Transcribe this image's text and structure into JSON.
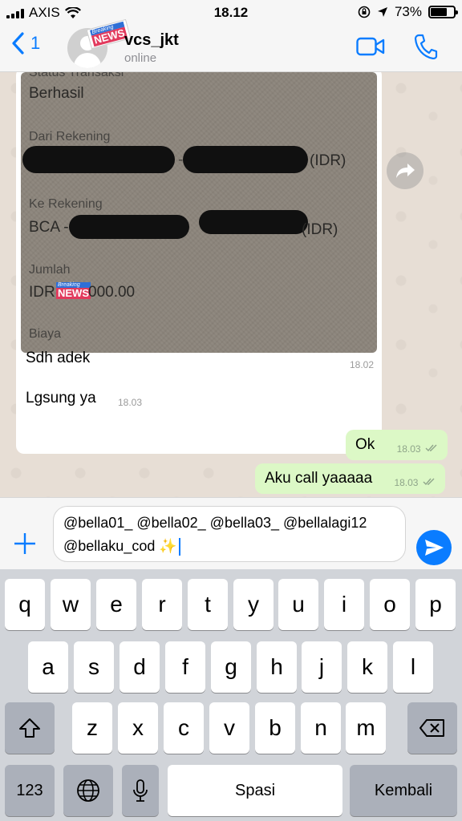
{
  "status_bar": {
    "carrier": "AXIS",
    "time": "18.12",
    "battery_percent": "73%",
    "battery_level": 0.73
  },
  "header": {
    "back_count": "1",
    "contact_name": "vcs_jkt",
    "contact_status": "online",
    "badge_top": "Breaking",
    "badge_bottom": "NEWS"
  },
  "chat": {
    "receipt": {
      "status_label": "Status Transaksi",
      "status_value": "Berhasil",
      "from_label": "Dari Rekening",
      "from_suffix": "(IDR)",
      "to_label": "Ke Rekening",
      "to_prefix": "BCA -",
      "to_suffix": "(IDR)",
      "amount_label": "Jumlah",
      "amount_prefix": "IDR",
      "amount_suffix": "000.00",
      "fee_label": "Biaya",
      "badge_top": "Breaking",
      "badge_bottom": "NEWS"
    },
    "messages": [
      {
        "direction": "in",
        "text": "Sdh adek",
        "time": "18.02"
      },
      {
        "direction": "in",
        "text": "Lgsung ya",
        "time": "18.03"
      },
      {
        "direction": "out",
        "text": "Ok",
        "time": "18.03"
      },
      {
        "direction": "out",
        "text": "Aku call yaaaaa",
        "time": "18.03"
      }
    ]
  },
  "composer": {
    "line1": "@bella01_ @bella02_ @bella03_ @bellalagi12",
    "line2": "@bellaku_cod ✨"
  },
  "keyboard": {
    "row1": [
      "q",
      "w",
      "e",
      "r",
      "t",
      "y",
      "u",
      "i",
      "o",
      "p"
    ],
    "row2": [
      "a",
      "s",
      "d",
      "f",
      "g",
      "h",
      "j",
      "k",
      "l"
    ],
    "row3": [
      "z",
      "x",
      "c",
      "v",
      "b",
      "n",
      "m"
    ],
    "numbers": "123",
    "space": "Spasi",
    "return": "Kembali",
    "icons": [
      "shift-icon",
      "backspace-icon",
      "globe-icon",
      "microphone-icon"
    ]
  },
  "colors": {
    "accent": "#0a7cff",
    "outgoing_bubble": "#dcf8c6",
    "chat_bg": "#e7ded5"
  }
}
